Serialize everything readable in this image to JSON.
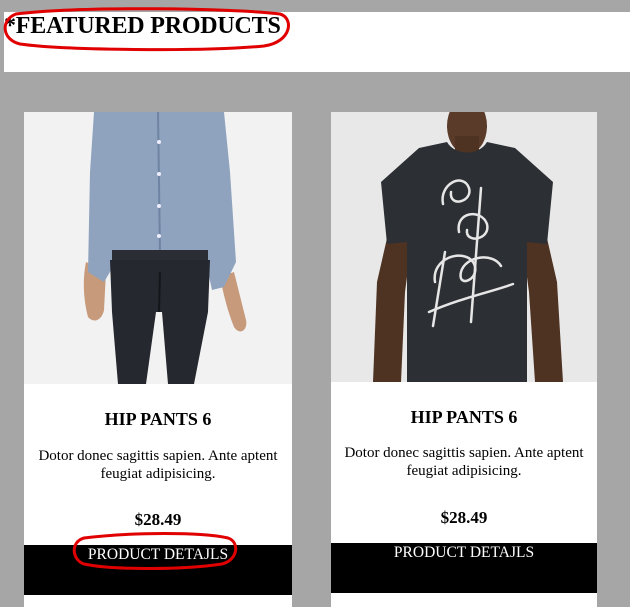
{
  "header": {
    "title": "*FEATURED PRODUCTS"
  },
  "products": [
    {
      "name": "HIP PANTS 6",
      "description": "Dotor donec sagittis sapien. Ante aptent feugiat adipisicing.",
      "price": "$28.49",
      "button_label": "PRODUCT DETAJLS",
      "image": "man-in-blue-shirt-and-black-jeans"
    },
    {
      "name": "HIP PANTS 6",
      "description": "Dotor donec sagittis sapien. Ante aptent feugiat adipisicing.",
      "price": "$28.49",
      "button_label": "PRODUCT DETAJLS",
      "image": "man-in-dark-graphic-t-shirt"
    }
  ],
  "colors": {
    "page_background": "#a6a6a6",
    "button_background": "#000000",
    "annotation": "#e00000"
  }
}
